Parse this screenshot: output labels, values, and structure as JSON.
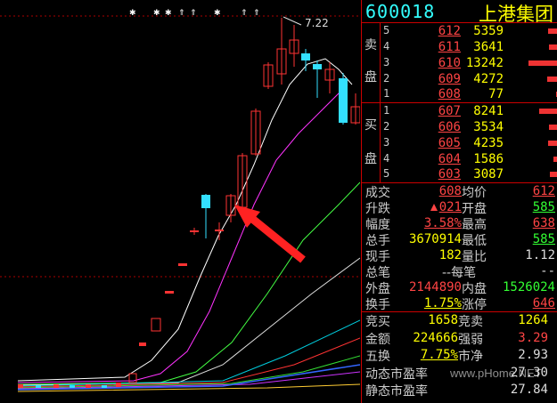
{
  "stock": {
    "code": "600018",
    "name": "上港集团"
  },
  "sell_label_1": "卖",
  "sell_label_2": "盘",
  "buy_label_1": "买",
  "buy_label_2": "盘",
  "sell": [
    {
      "level": "5",
      "price": "612",
      "volume": "5359"
    },
    {
      "level": "4",
      "price": "611",
      "volume": "3641"
    },
    {
      "level": "3",
      "price": "610",
      "volume": "13242"
    },
    {
      "level": "2",
      "price": "609",
      "volume": "4272"
    },
    {
      "level": "1",
      "price": "608",
      "volume": "77"
    }
  ],
  "buy": [
    {
      "level": "1",
      "price": "607",
      "volume": "8241"
    },
    {
      "level": "2",
      "price": "606",
      "volume": "3534"
    },
    {
      "level": "3",
      "price": "605",
      "volume": "4235"
    },
    {
      "level": "4",
      "price": "604",
      "volume": "1586"
    },
    {
      "level": "5",
      "price": "603",
      "volume": "3087"
    }
  ],
  "quote": {
    "chengjiao_label": "成交",
    "chengjiao": "608",
    "junjia_label": "均价",
    "junjia": "612",
    "shengdie_label": "升跌",
    "shengdie": "021",
    "kaipan_label": "开盘",
    "kaipan": "585",
    "fudu_label": "幅度",
    "fudu": "3.58%",
    "zuigao_label": "最高",
    "zuigao": "638",
    "zongshou_label": "总手",
    "zongshou": "3670914",
    "zuidi_label": "最低",
    "zuidi": "585",
    "xianshou_label": "现手",
    "xianshou": "182",
    "liangbi_label": "量比",
    "liangbi": "1.12",
    "zongbi_label": "总笔",
    "zongbi": "--每笔",
    "zongbi_right": "--",
    "waipan_label": "外盘",
    "waipan": "2144890",
    "neipan_label": "内盘",
    "neipan": "1526024",
    "huanshou_label": "换手",
    "huanshou": "1.75%",
    "zhangting_label": "涨停",
    "zhangting": "646",
    "jingmai_label": "竞买",
    "jingmai": "1658",
    "jingmai2_label": "竞卖",
    "jingmai2": "1264",
    "jine_label": "金额",
    "jine": "224666",
    "qiangruo_label": "强弱",
    "qiangruo": "3.29",
    "wuhuan_label": "五换",
    "wuhuan": "7.75%",
    "shijing_label": "市净",
    "shijing": "2.93",
    "dongtai_label": "动态市盈率",
    "dongtai": "27.30",
    "jingtai_label": "静态市盈率",
    "jingtai": "27.84"
  },
  "chart_data": {
    "type": "candlestick",
    "peak_label": "7.22",
    "colors": {
      "up": "#ff3333",
      "down": "#33e0ff",
      "ma5": "#ffffff",
      "ma10": "#ff33ff",
      "ma20": "#33ff33",
      "ma60": "#3366ff",
      "arrow": "#ff2222"
    }
  },
  "watermark": "www.pHome.NET"
}
